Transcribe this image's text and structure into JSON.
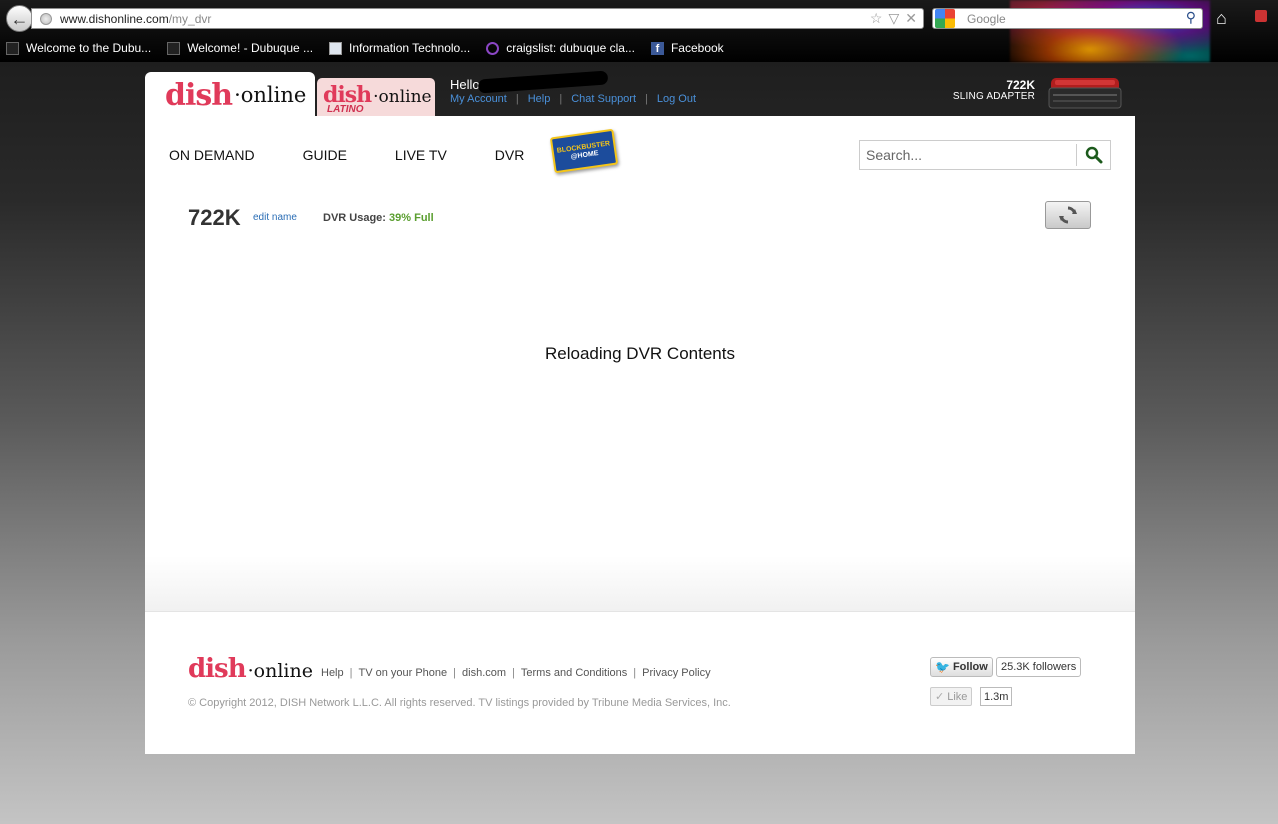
{
  "browser": {
    "back_symbol": "←",
    "url_host": "www.dishonline.com",
    "url_path": "/my_dvr",
    "search_placeholder": "Google",
    "bookmarks": [
      {
        "label": "Welcome to the Dubu...",
        "icon": "page-icon"
      },
      {
        "label": "Welcome! - Dubuque ...",
        "icon": "page-icon"
      },
      {
        "label": "Information Technolo...",
        "icon": "info-page-icon"
      },
      {
        "label": "craigslist: dubuque cla...",
        "icon": "peace-icon"
      },
      {
        "label": "Facebook",
        "icon": "facebook-icon"
      }
    ]
  },
  "header": {
    "logo": {
      "dish": "dish",
      "online": "·online"
    },
    "latino_logo": {
      "dish": "dish",
      "online": "·online",
      "sub": "LATINO"
    },
    "greeting": "Hello, C",
    "account_links": [
      "My Account",
      "Help",
      "Chat Support",
      "Log Out"
    ],
    "sling": {
      "name": "722K",
      "label": "SLING ADAPTER"
    }
  },
  "nav": {
    "items": [
      "ON DEMAND",
      "GUIDE",
      "LIVE TV",
      "DVR"
    ],
    "blockbuster": {
      "line1": "BLOCKBUSTER",
      "line2": "@HOME"
    }
  },
  "site_search": {
    "placeholder": "Search..."
  },
  "dvr": {
    "name": "722K",
    "edit_label": "edit name",
    "usage_label": "DVR Usage:",
    "usage_value": "39% Full",
    "status_message": "Reloading DVR Contents"
  },
  "footer": {
    "logo": {
      "dish": "dish",
      "online": "·online"
    },
    "links": [
      "Help",
      "TV on your Phone",
      "dish.com",
      "Terms and Conditions",
      "Privacy Policy"
    ],
    "copyright": "© Copyright 2012, DISH Network L.L.C. All rights reserved. TV listings provided by Tribune Media Services, Inc.",
    "twitter": {
      "label": "Follow",
      "count": "25.3K followers"
    },
    "like": {
      "label": "Like",
      "count": "1.3m"
    }
  },
  "colors": {
    "brand_pink": "#e03a5a",
    "link_blue": "#4a90d9",
    "usage_green": "#5a9e2f"
  }
}
